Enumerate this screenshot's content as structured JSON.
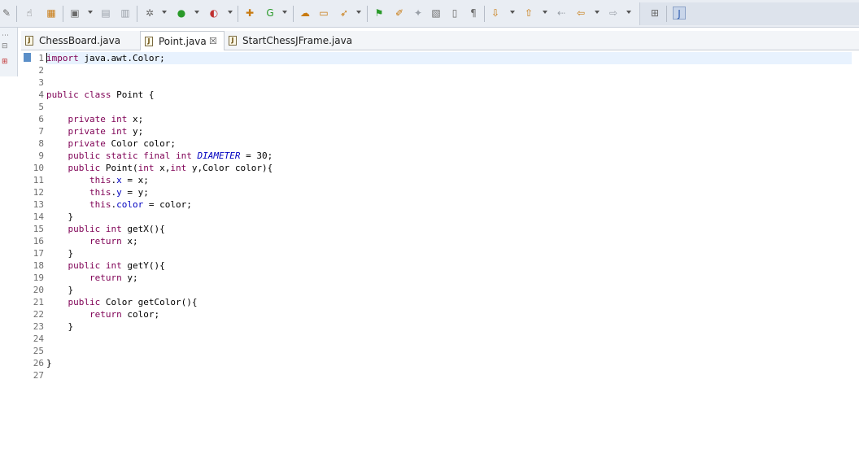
{
  "toolbar": {
    "icons": [
      {
        "name": "pin-editor-icon",
        "glyph": "✎"
      },
      {
        "name": "toggle-mark-icon",
        "glyph": "☝"
      },
      {
        "name": "package-icon",
        "glyph": "▦"
      },
      {
        "name": "new-wizard-icon",
        "glyph": "▣"
      },
      {
        "name": "save-icon",
        "glyph": "▤"
      },
      {
        "name": "save-all-icon",
        "glyph": "▥"
      },
      {
        "name": "debug-icon",
        "glyph": "✲"
      },
      {
        "name": "run-icon",
        "glyph": "●"
      },
      {
        "name": "run-external-icon",
        "glyph": "◐"
      },
      {
        "name": "new-java-project-icon",
        "glyph": "✚"
      },
      {
        "name": "new-class-icon",
        "glyph": "G"
      },
      {
        "name": "open-type-icon",
        "glyph": "☁"
      },
      {
        "name": "open-folder-icon",
        "glyph": "▭"
      },
      {
        "name": "search-icon",
        "glyph": "➶"
      },
      {
        "name": "toggle-breadcrumb-icon",
        "glyph": "⚑"
      },
      {
        "name": "mark-occurrences-icon",
        "glyph": "✐"
      },
      {
        "name": "toggle-block-icon",
        "glyph": "✦"
      },
      {
        "name": "word-wrap-icon",
        "glyph": "▧"
      },
      {
        "name": "show-whitespace-icon",
        "glyph": "▯"
      },
      {
        "name": "pilcrow-icon",
        "glyph": "¶"
      },
      {
        "name": "next-annotation-icon",
        "glyph": "⇩"
      },
      {
        "name": "previous-annotation-icon",
        "glyph": "⇧"
      },
      {
        "name": "last-edit-icon",
        "glyph": "⇠"
      },
      {
        "name": "back-icon",
        "glyph": "⇦"
      },
      {
        "name": "forward-icon",
        "glyph": "⇨"
      },
      {
        "name": "open-perspective-icon",
        "glyph": "⊞"
      },
      {
        "name": "java-perspective-icon",
        "glyph": "J"
      }
    ]
  },
  "tabs": [
    {
      "label": "ChessBoard.java",
      "active": false
    },
    {
      "label": "Point.java",
      "active": true
    },
    {
      "label": "StartChessJFrame.java",
      "active": false
    }
  ],
  "tab_close_glyph": "☒",
  "editor": {
    "line_numbers": [
      "1",
      "2",
      "3",
      "4",
      "5",
      "6",
      "7",
      "8",
      "9",
      "10",
      "11",
      "12",
      "13",
      "14",
      "15",
      "16",
      "17",
      "18",
      "19",
      "20",
      "21",
      "22",
      "23",
      "24",
      "25",
      "26",
      "27"
    ],
    "lines": [
      "import java.awt.Color;",
      "",
      "",
      "public class Point {",
      "",
      "    private int x;",
      "    private int y;",
      "    private Color color;",
      "    public static final int DIAMETER = 30;",
      "    public Point(int x,int y,Color color){",
      "        this.x = x;",
      "        this.y = y;",
      "        this.color = color;",
      "    }",
      "    public int getX(){",
      "        return x;",
      "    }",
      "    public int getY(){",
      "        return y;",
      "    }",
      "    public Color getColor(){",
      "        return color;",
      "    }",
      "",
      "",
      "}",
      ""
    ]
  },
  "colors": {
    "keyword": "#7f0055",
    "field": "#0000c0",
    "current_line": "#e8f2fe",
    "toolbar_bg": "#e9edf3"
  }
}
